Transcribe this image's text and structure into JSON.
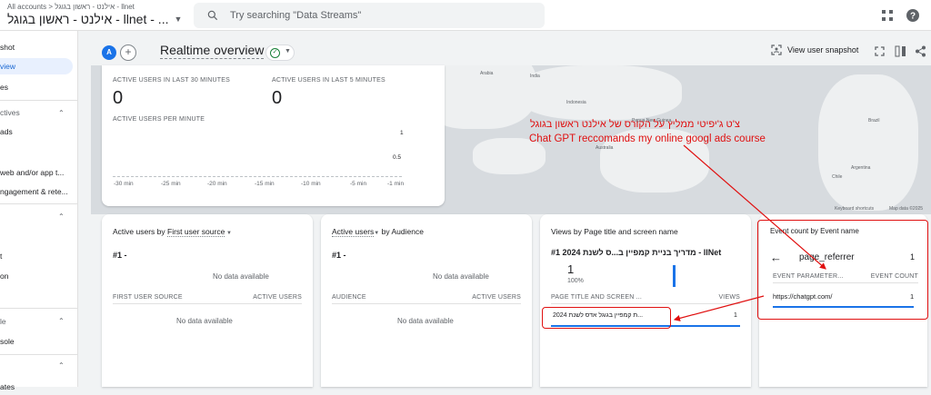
{
  "topbar": {
    "breadcrumb": "All accounts > אילנט - ראשון בגוגל - llnet",
    "property": "אילנט - ראשון בגוגל - llnet - ...",
    "search_placeholder": "Try searching \"Data Streams\"",
    "apps_icon": "apps-grid-icon",
    "help_icon": "help-icon"
  },
  "sidebar": {
    "items": [
      {
        "label": "shot",
        "active": false
      },
      {
        "label": "view",
        "active": true
      },
      {
        "label": "es",
        "active": false
      },
      {
        "label": "ctives",
        "active": false,
        "section": true
      },
      {
        "label": "ads",
        "active": false
      },
      {
        "label": "web and/or app t...",
        "active": false
      },
      {
        "label": "ngagement & rete...",
        "active": false
      },
      {
        "label": "t",
        "active": false
      },
      {
        "label": "on",
        "active": false
      },
      {
        "label": "le",
        "active": false,
        "section": true
      },
      {
        "label": "sole",
        "active": false
      },
      {
        "label": "ates",
        "active": false
      }
    ]
  },
  "toolbar": {
    "avatar": "A",
    "add": "+",
    "title": "Realtime overview",
    "view_snapshot": "View user snapshot"
  },
  "realtime": {
    "kpi1_label": "ACTIVE USERS IN LAST 30 MINUTES",
    "kpi1_value": "0",
    "kpi2_label": "ACTIVE USERS IN LAST 5 MINUTES",
    "kpi2_value": "0",
    "per_minute_label": "ACTIVE USERS PER MINUTE",
    "y_ticks": [
      "1",
      "0.5"
    ],
    "x_ticks": [
      "-30 min",
      "-25 min",
      "-20 min",
      "-15 min",
      "-10 min",
      "-5 min",
      "-1 min"
    ]
  },
  "map": {
    "footer": [
      "Keyboard shortcuts",
      "Map data ©2025"
    ],
    "labels": [
      "Arabia",
      "India",
      "Indonesia",
      "Papua New Guinea",
      "Australia",
      "Argentina",
      "Brazil",
      "Chile"
    ]
  },
  "cards": {
    "source": {
      "title_a": "Active users by ",
      "title_b": "First user source",
      "rank": "#1 -",
      "nodata_top": "No data available",
      "col1": "FIRST USER SOURCE",
      "col2": "ACTIVE USERS",
      "nodata_bottom": "No data available"
    },
    "audience": {
      "title_a": "Active users",
      "title_b": " by Audience",
      "rank": "#1 -",
      "nodata_top": "No data available",
      "col1": "AUDIENCE",
      "col2": "ACTIVE USERS",
      "nodata_bottom": "No data available"
    },
    "views": {
      "title": "Views by Page title and screen name",
      "rank": "#1  מדריך בניית קמפיין ב...ס לשנת 2024 - llNet",
      "value": "1",
      "pct": "100%",
      "col1": "PAGE TITLE AND SCREEN ...",
      "col2": "VIEWS",
      "row_label": "2024 ת קמפיין בגוגל אדס לשנת...",
      "row_value": "1"
    },
    "events": {
      "title": "Event count by Event name",
      "back_icon": "arrow-left-icon",
      "event_name": "page_referrer",
      "event_count": "1",
      "col1": "EVENT PARAMETER...",
      "col2": "EVENT COUNT",
      "row_label": "https://chatgpt.com/",
      "row_value": "1"
    }
  },
  "annotation": {
    "line1": "צ'ט ג'יפיטי ממליץ על הקורס של אילנט ראשון בגוגל",
    "line2": "Chat GPT reccomands my online googl ads course",
    "color": "#e01010"
  }
}
